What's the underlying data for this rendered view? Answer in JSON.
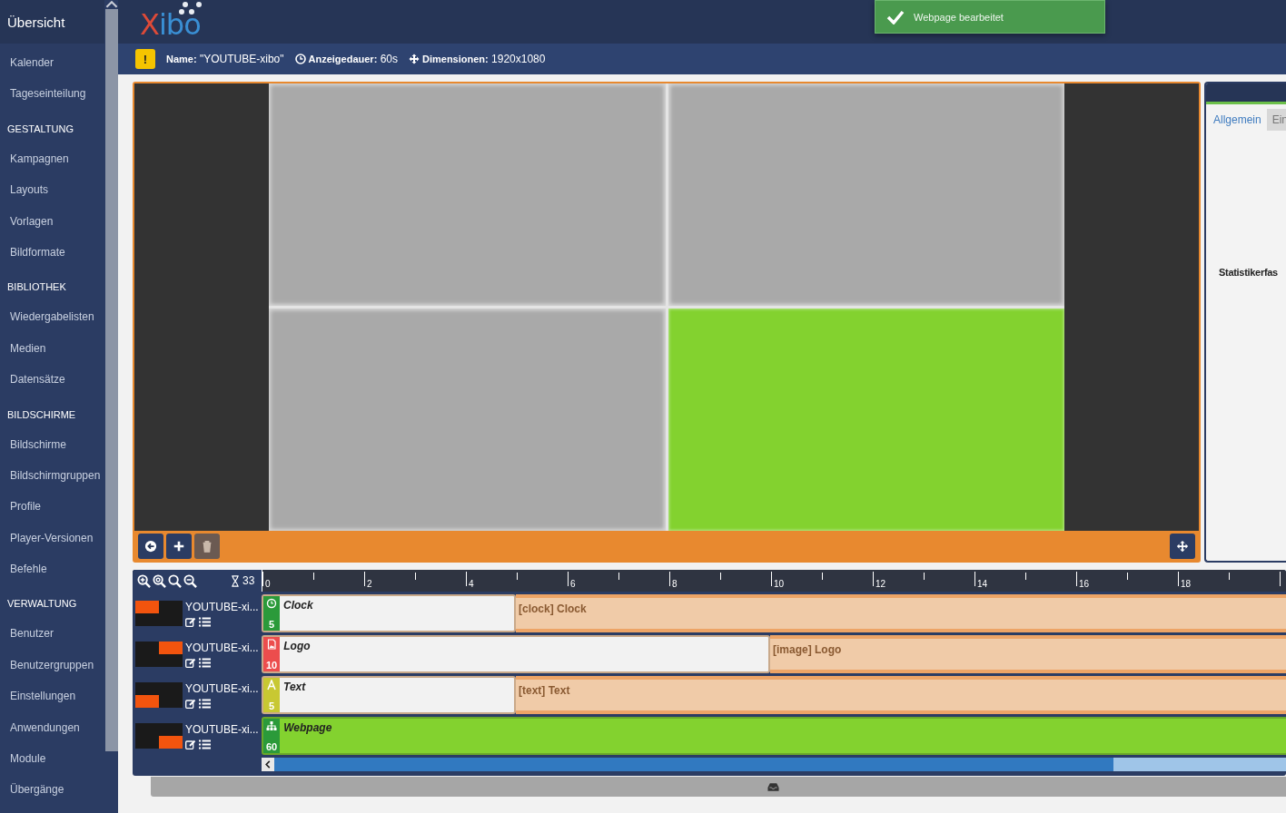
{
  "sidebar": {
    "title": "Übersicht",
    "sections": [
      {
        "items": [
          {
            "label": "Kalender"
          },
          {
            "label": "Tageseinteilung"
          }
        ]
      },
      {
        "heading": "GESTALTUNG",
        "items": [
          {
            "label": "Kampagnen"
          },
          {
            "label": "Layouts"
          },
          {
            "label": "Vorlagen"
          },
          {
            "label": "Bildformate"
          }
        ]
      },
      {
        "heading": "BIBLIOTHEK",
        "items": [
          {
            "label": "Wiedergabelisten"
          },
          {
            "label": "Medien"
          },
          {
            "label": "Datensätze"
          }
        ]
      },
      {
        "heading": "BILDSCHIRME",
        "items": [
          {
            "label": "Bildschirme"
          },
          {
            "label": "Bildschirmgruppen"
          },
          {
            "label": "Profile"
          },
          {
            "label": "Player-Versionen"
          },
          {
            "label": "Befehle"
          }
        ]
      },
      {
        "heading": "VERWALTUNG",
        "items": [
          {
            "label": "Benutzer"
          },
          {
            "label": "Benutzergruppen"
          },
          {
            "label": "Einstellungen"
          },
          {
            "label": "Anwendungen"
          },
          {
            "label": "Module"
          },
          {
            "label": "Übergänge"
          }
        ]
      }
    ]
  },
  "header": {
    "logo": "Xibo"
  },
  "toast": {
    "message": "Webpage bearbeitet"
  },
  "info_bar": {
    "warning": "!",
    "items": [
      {
        "kind": "name",
        "text": "**Name:** \"YOUTUBE-xibo\""
      },
      {
        "kind": "duration",
        "text": "**Anzeigedauer:** 60s"
      },
      {
        "kind": "dimensions",
        "text": "**Dimensionen:** 1920x1080"
      }
    ]
  },
  "preview": {
    "regions": [
      {
        "selected": false
      },
      {
        "selected": false
      },
      {
        "selected": false
      },
      {
        "selected": true
      }
    ],
    "toolbar": [
      {
        "kind": "back",
        "disabled": false
      },
      {
        "kind": "add",
        "disabled": false
      },
      {
        "kind": "delete",
        "disabled": true
      }
    ]
  },
  "properties_panel": {
    "tabs": [
      {
        "label": "Allgemein",
        "selected": true
      },
      {
        "label": "Ein",
        "selected": false
      }
    ],
    "field_label": "Statistikerfas"
  },
  "timeline": {
    "duration": "33",
    "ruler": [
      "0",
      "2",
      "4",
      "6",
      "8",
      "10",
      "12",
      "14",
      "16",
      "18"
    ],
    "rows": [
      {
        "name": "YOUTUBE-xi...",
        "widget": {
          "kind": "clock",
          "title": "Clock",
          "duration": "5",
          "color": "#2b9a3a",
          "selected": false
        },
        "loop": "[clock] Clock"
      },
      {
        "name": "YOUTUBE-xi...",
        "widget": {
          "kind": "image",
          "title": "Logo",
          "duration": "10",
          "color": "#ec4d4d",
          "selected": false
        },
        "loop": "[image] Logo"
      },
      {
        "name": "YOUTUBE-xi...",
        "widget": {
          "kind": "text",
          "title": "Text",
          "duration": "5",
          "color": "#c8c832",
          "selected": false
        },
        "loop": "[text] Text"
      },
      {
        "name": "YOUTUBE-xi...",
        "widget": {
          "kind": "webpage",
          "title": "Webpage",
          "duration": "60",
          "color": "#2b9a3a",
          "selected": true
        }
      }
    ]
  }
}
